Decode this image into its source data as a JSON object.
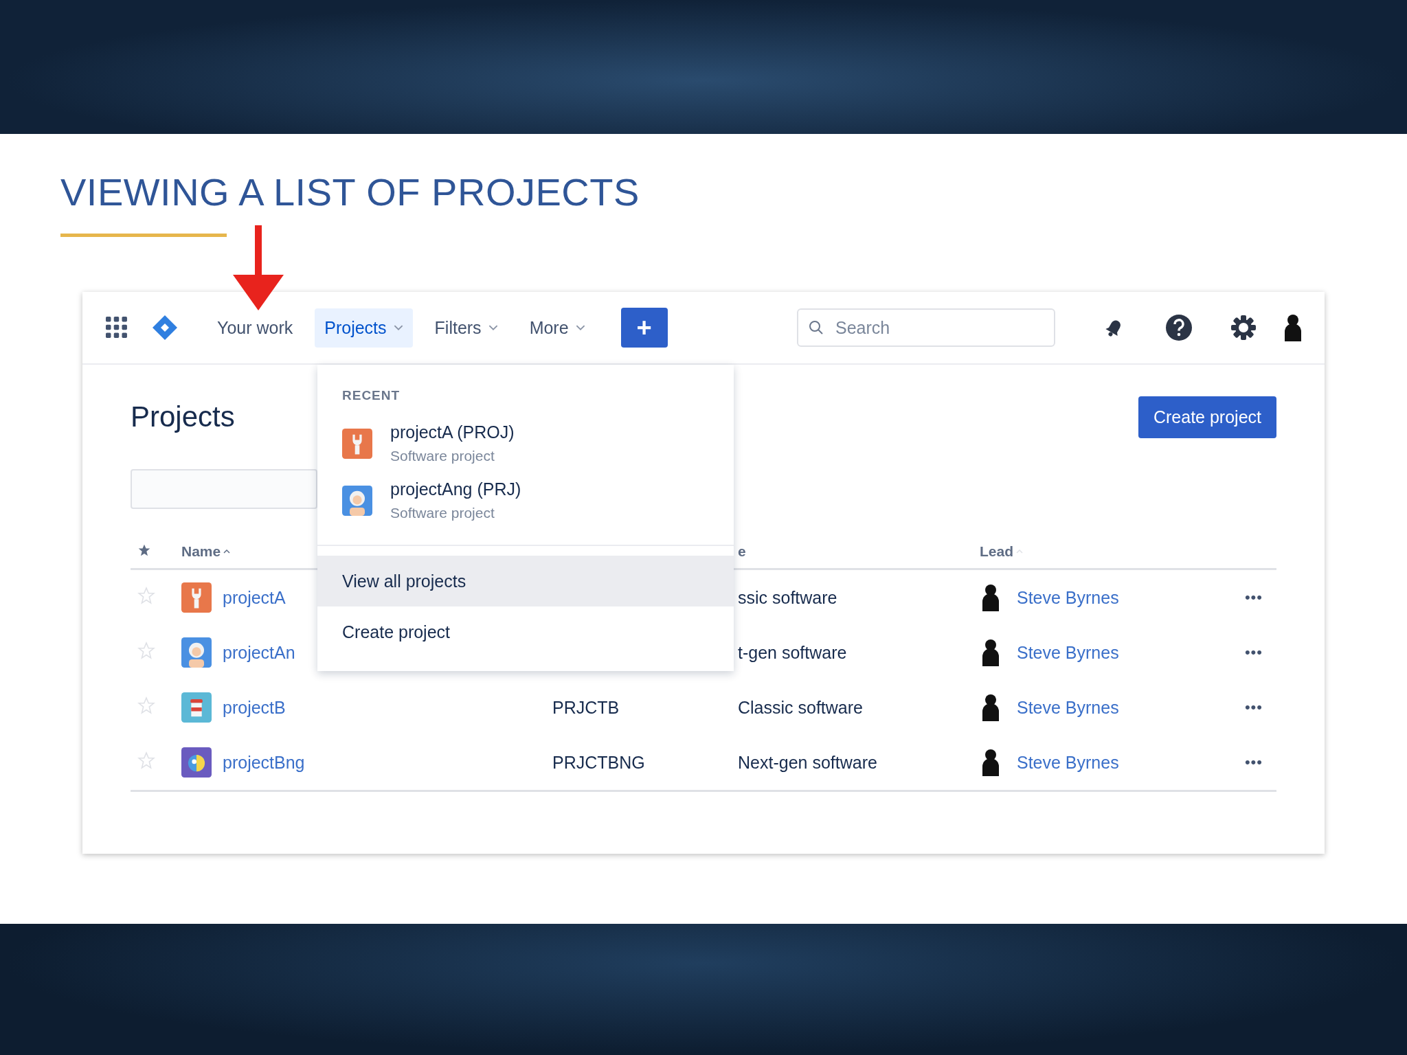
{
  "slide": {
    "title": "VIEWING A LIST OF PROJECTS"
  },
  "nav": {
    "items": [
      {
        "label": "Your work",
        "selected": false,
        "dropdown": false
      },
      {
        "label": "Projects",
        "selected": true,
        "dropdown": true
      },
      {
        "label": "Filters",
        "selected": false,
        "dropdown": true
      },
      {
        "label": "More",
        "selected": false,
        "dropdown": true
      }
    ],
    "create_label": "+",
    "search": {
      "placeholder": "Search"
    }
  },
  "page": {
    "title": "Projects",
    "create_button": "Create project"
  },
  "table": {
    "header": {
      "name": "Name",
      "type": "e",
      "lead": "Lead"
    },
    "rows": [
      {
        "starred": false,
        "kind": "wrench",
        "name": "projectA",
        "type": "ssic software",
        "lead": "Steve Byrnes",
        "menu": "•••"
      },
      {
        "starred": false,
        "kind": "person",
        "name": "projectAn",
        "type": "t-gen software",
        "lead": "Steve Byrnes",
        "menu": "•••"
      },
      {
        "starred": false,
        "kind": "cup",
        "name": "projectB",
        "key": "PRJCTB",
        "type": "Classic software",
        "lead": "Steve Byrnes",
        "menu": "•••"
      },
      {
        "starred": false,
        "kind": "bird",
        "name": "projectBng",
        "key": "PRJCTBNG",
        "type": "Next-gen software",
        "lead": "Steve Byrnes",
        "menu": "•••"
      }
    ]
  },
  "dropdown": {
    "heading": "RECENT",
    "recent": [
      {
        "kind": "wrench",
        "name": "projectA (PROJ)",
        "subtitle": "Software project"
      },
      {
        "kind": "person",
        "name": "projectAng (PRJ)",
        "subtitle": "Software project"
      }
    ],
    "actions": [
      {
        "label": "View all projects",
        "selected": true
      },
      {
        "label": "Create project",
        "selected": false
      }
    ]
  }
}
